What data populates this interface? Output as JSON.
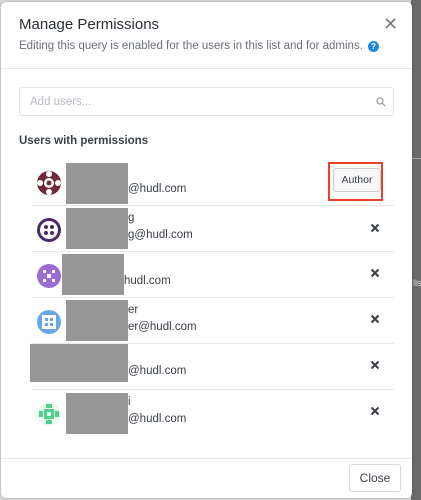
{
  "dialog": {
    "title": "Manage Permissions",
    "subtitle": "Editing this query is enabled for the users in this list and for admins.",
    "close_icon": "close-icon",
    "help_icon": "help-icon"
  },
  "search": {
    "placeholder": "Add users...",
    "icon": "search-icon"
  },
  "section_heading": "Users with permissions",
  "users": [
    {
      "name": "",
      "email": "@hudl.com",
      "role": "Author",
      "avatar_color": "#6e2a3a"
    },
    {
      "name": "g",
      "email": "g@hudl.com",
      "role": "",
      "avatar_color": "#4a2a66"
    },
    {
      "name": "",
      "email": "hudl.com",
      "role": "",
      "avatar_color": "#9b6bd6"
    },
    {
      "name": "er",
      "email": "er@hudl.com",
      "role": "",
      "avatar_color": "#6aa7e8"
    },
    {
      "name": "",
      "email": "@hudl.com",
      "role": "",
      "avatar_color": "#9a9a9a"
    },
    {
      "name": "i",
      "email": "@hudl.com",
      "role": "",
      "avatar_color": "#4fd18b"
    }
  ],
  "footer": {
    "close_label": "Close"
  },
  "colors": {
    "accent": "#1e88e5",
    "highlight": "#e8432a"
  }
}
